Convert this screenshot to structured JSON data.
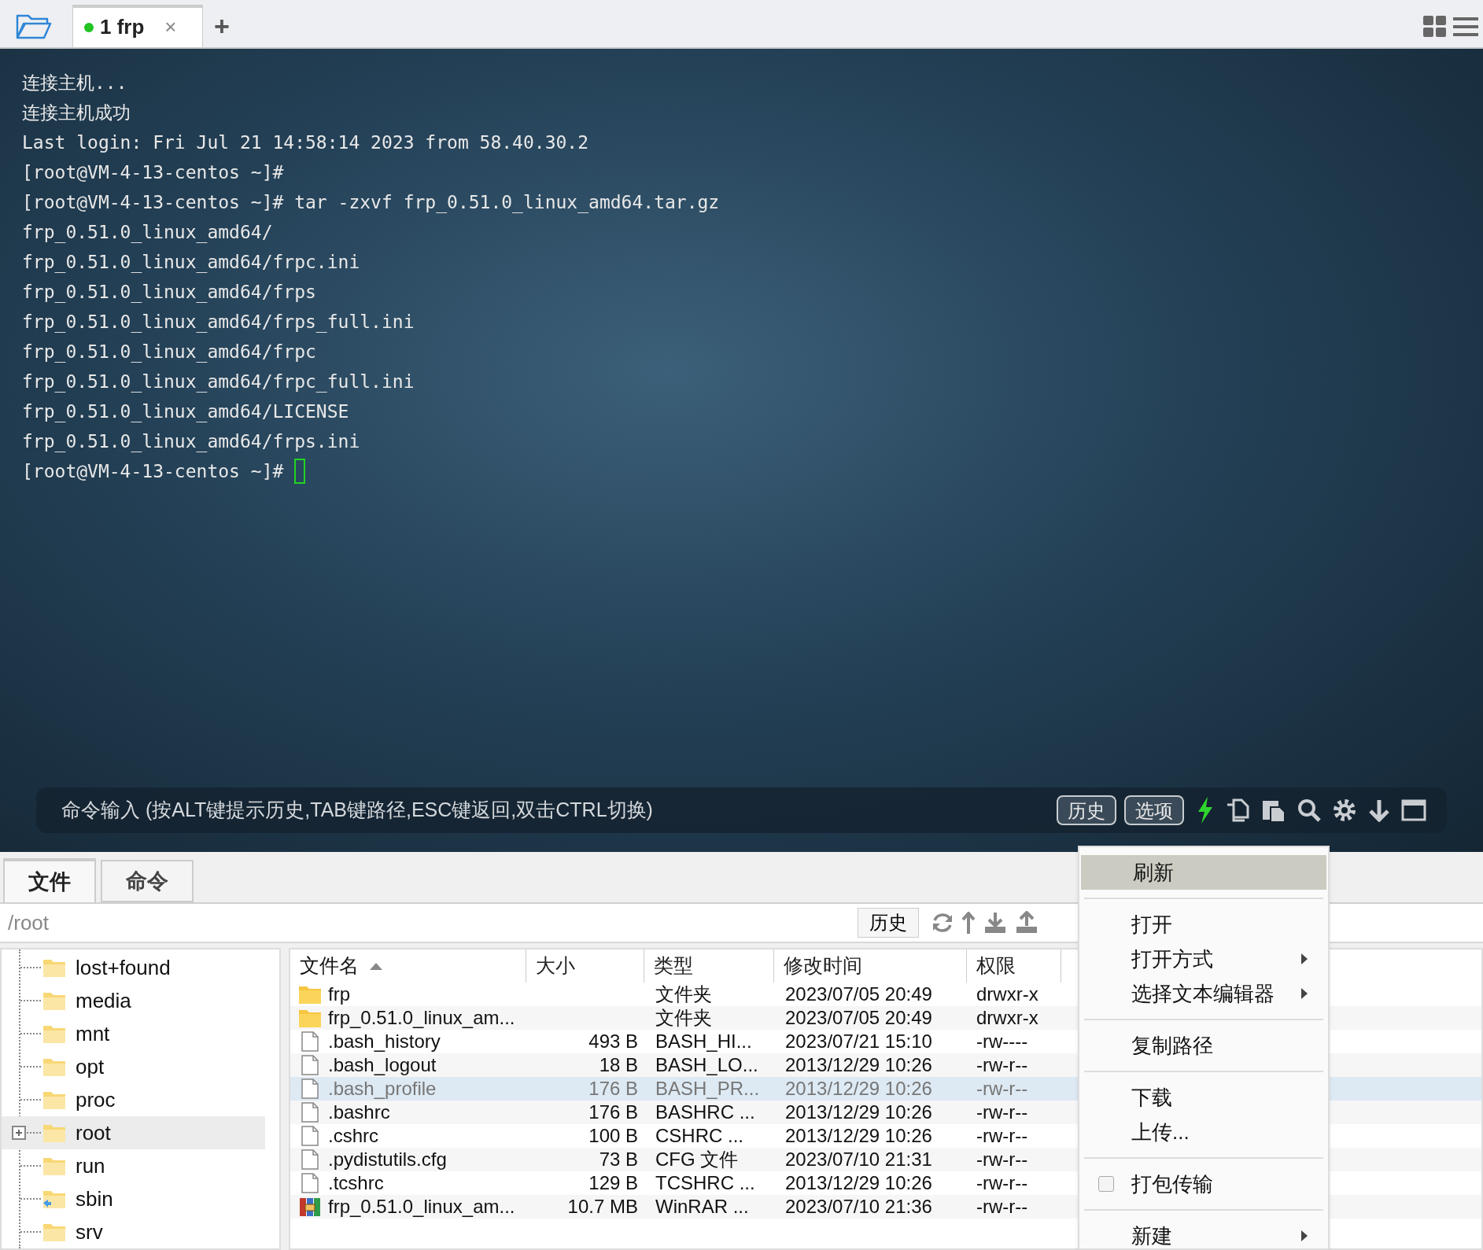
{
  "tabs": [
    {
      "label": "1 frp",
      "selected": true,
      "connected": true,
      "close": "×"
    }
  ],
  "new_tab": "+",
  "terminal": {
    "lines": [
      "连接主机...",
      "连接主机成功",
      "Last login: Fri Jul 21 14:58:14 2023 from 58.40.30.2",
      "[root@VM-4-13-centos ~]#",
      "[root@VM-4-13-centos ~]# tar -zxvf frp_0.51.0_linux_amd64.tar.gz",
      "frp_0.51.0_linux_amd64/",
      "frp_0.51.0_linux_amd64/frpc.ini",
      "frp_0.51.0_linux_amd64/frps",
      "frp_0.51.0_linux_amd64/frps_full.ini",
      "frp_0.51.0_linux_amd64/frpc",
      "frp_0.51.0_linux_amd64/frpc_full.ini",
      "frp_0.51.0_linux_amd64/LICENSE",
      "frp_0.51.0_linux_amd64/frps.ini",
      "[root@VM-4-13-centos ~]# "
    ],
    "cursor": true
  },
  "command_bar": {
    "placeholder": "命令输入 (按ALT键提示历史,TAB键路径,ESC键返回,双击CTRL切换)",
    "buttons": [
      "历史",
      "选项"
    ]
  },
  "panel_tabs": [
    {
      "label": "文件",
      "selected": true
    },
    {
      "label": "命令",
      "selected": false
    }
  ],
  "path": "/root",
  "history_button": "历史",
  "tree": [
    {
      "label": "lost+found",
      "selected": false,
      "expandable": false,
      "link": false
    },
    {
      "label": "media",
      "selected": false,
      "expandable": false,
      "link": false
    },
    {
      "label": "mnt",
      "selected": false,
      "expandable": false,
      "link": false
    },
    {
      "label": "opt",
      "selected": false,
      "expandable": false,
      "link": false
    },
    {
      "label": "proc",
      "selected": false,
      "expandable": false,
      "link": false
    },
    {
      "label": "root",
      "selected": true,
      "expandable": true,
      "link": false
    },
    {
      "label": "run",
      "selected": false,
      "expandable": false,
      "link": false
    },
    {
      "label": "sbin",
      "selected": false,
      "expandable": false,
      "link": true
    },
    {
      "label": "srv",
      "selected": false,
      "expandable": false,
      "link": false
    }
  ],
  "files": {
    "columns": [
      {
        "label": "文件名",
        "sorted": true
      },
      {
        "label": "大小",
        "sorted": false
      },
      {
        "label": "类型",
        "sorted": false
      },
      {
        "label": "修改时间",
        "sorted": false
      },
      {
        "label": "权限",
        "sorted": false
      }
    ],
    "rows": [
      {
        "kind": "folder",
        "name": "frp",
        "size": "",
        "type": "文件夹",
        "modified": "2023/07/05 20:49",
        "permissions": "drwxr-x",
        "selected": false
      },
      {
        "kind": "folder",
        "name": "frp_0.51.0_linux_am...",
        "size": "",
        "type": "文件夹",
        "modified": "2023/07/05 20:49",
        "permissions": "drwxr-x",
        "selected": false
      },
      {
        "kind": "file",
        "name": ".bash_history",
        "size": "493 B",
        "type": "BASH_HI...",
        "modified": "2023/07/21 15:10",
        "permissions": "-rw----",
        "selected": false
      },
      {
        "kind": "file",
        "name": ".bash_logout",
        "size": "18 B",
        "type": "BASH_LO...",
        "modified": "2013/12/29 10:26",
        "permissions": "-rw-r--",
        "selected": false
      },
      {
        "kind": "file",
        "name": ".bash_profile",
        "size": "176 B",
        "type": "BASH_PR...",
        "modified": "2013/12/29 10:26",
        "permissions": "-rw-r--",
        "selected": true
      },
      {
        "kind": "file",
        "name": ".bashrc",
        "size": "176 B",
        "type": "BASHRC ...",
        "modified": "2013/12/29 10:26",
        "permissions": "-rw-r--",
        "selected": false
      },
      {
        "kind": "file",
        "name": ".cshrc",
        "size": "100 B",
        "type": "CSHRC ...",
        "modified": "2013/12/29 10:26",
        "permissions": "-rw-r--",
        "selected": false
      },
      {
        "kind": "file",
        "name": ".pydistutils.cfg",
        "size": "73 B",
        "type": "CFG 文件",
        "modified": "2023/07/10 21:31",
        "permissions": "-rw-r--",
        "selected": false
      },
      {
        "kind": "file",
        "name": ".tcshrc",
        "size": "129 B",
        "type": "TCSHRC ...",
        "modified": "2013/12/29 10:26",
        "permissions": "-rw-r--",
        "selected": false
      },
      {
        "kind": "archive",
        "name": "frp_0.51.0_linux_am...",
        "size": "10.7 MB",
        "type": "WinRAR ...",
        "modified": "2023/07/10 21:36",
        "permissions": "-rw-r--",
        "selected": false
      }
    ]
  },
  "context_menu": [
    {
      "kind": "item",
      "label": "刷新",
      "highlighted": true,
      "submenu": false
    },
    {
      "kind": "separator"
    },
    {
      "kind": "item",
      "label": "打开",
      "highlighted": false,
      "submenu": false
    },
    {
      "kind": "item",
      "label": "打开方式",
      "highlighted": false,
      "submenu": true
    },
    {
      "kind": "item",
      "label": "选择文本编辑器",
      "highlighted": false,
      "submenu": true
    },
    {
      "kind": "separator"
    },
    {
      "kind": "item",
      "label": "复制路径",
      "highlighted": false,
      "submenu": false
    },
    {
      "kind": "separator"
    },
    {
      "kind": "item",
      "label": "下载",
      "highlighted": false,
      "submenu": false
    },
    {
      "kind": "item",
      "label": "上传...",
      "highlighted": false,
      "submenu": false
    },
    {
      "kind": "separator"
    },
    {
      "kind": "checkbox",
      "label": "打包传输",
      "checked": false
    },
    {
      "kind": "separator"
    },
    {
      "kind": "item",
      "label": "新建",
      "highlighted": false,
      "submenu": true
    }
  ]
}
